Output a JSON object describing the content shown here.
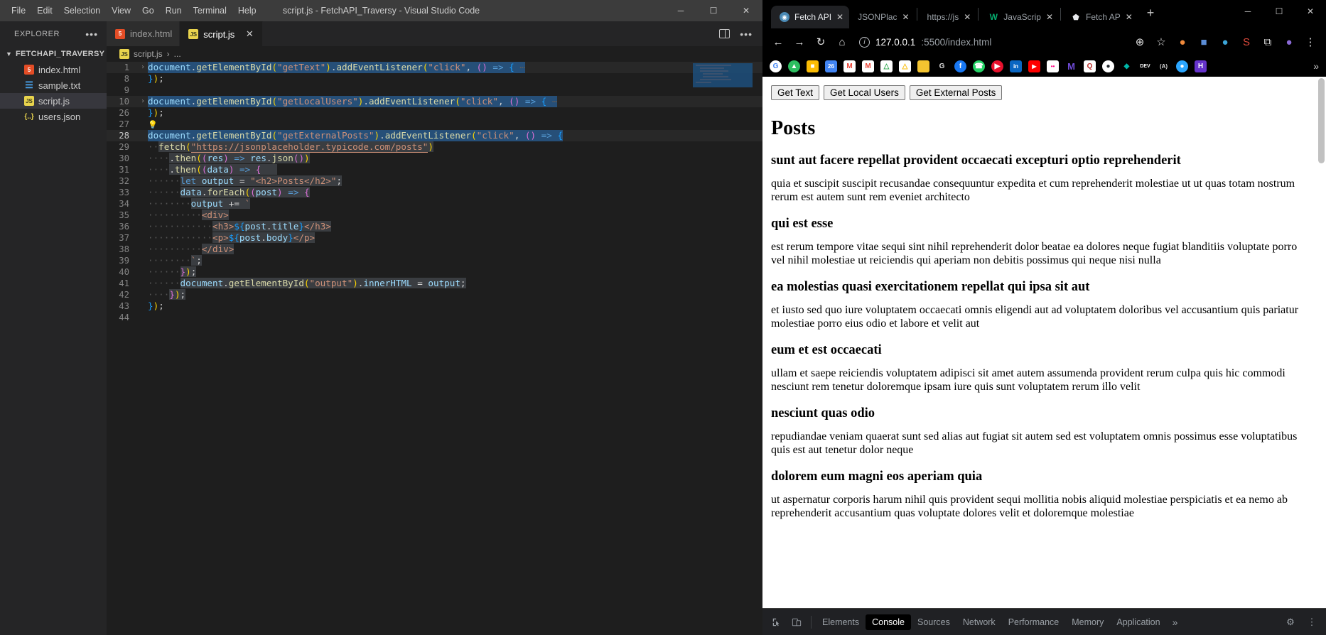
{
  "vscode": {
    "menu": [
      "File",
      "Edit",
      "Selection",
      "View",
      "Go",
      "Run",
      "Terminal",
      "Help"
    ],
    "window_title": "script.js - FetchAPI_Traversy - Visual Studio Code",
    "window_controls": {
      "minimize": "─",
      "maximize": "☐",
      "close": "✕"
    },
    "sidebar": {
      "header": "EXPLORER",
      "more": "•••",
      "root": "FETCHAPI_TRAVERSY",
      "files": [
        {
          "label": "index.html",
          "icon": "html5-icon",
          "glyph": "5",
          "selected": false
        },
        {
          "label": "sample.txt",
          "icon": "text-file-icon",
          "glyph": "☰",
          "selected": false
        },
        {
          "label": "script.js",
          "icon": "javascript-icon",
          "glyph": "JS",
          "selected": true
        },
        {
          "label": "users.json",
          "icon": "json-icon",
          "glyph": "{..}",
          "selected": false
        }
      ]
    },
    "tabs": [
      {
        "label": "index.html",
        "icon": "html5-icon",
        "glyph": "5",
        "active": false,
        "close": ""
      },
      {
        "label": "script.js",
        "icon": "javascript-icon",
        "glyph": "JS",
        "active": true,
        "close": "✕"
      }
    ],
    "tab_actions": {
      "split_editor": "split-editor-icon",
      "more": "•••"
    },
    "breadcrumb": {
      "icon_glyph": "JS",
      "file": "script.js",
      "chevron": "›",
      "rest": "..."
    },
    "code_lines": [
      {
        "num": "1",
        "fold": "›",
        "highlight": true
      },
      {
        "num": "8",
        "fold": "",
        "highlight": false
      },
      {
        "num": "9",
        "fold": "",
        "highlight": false
      },
      {
        "num": "10",
        "fold": "›",
        "highlight": true
      },
      {
        "num": "26",
        "fold": "",
        "highlight": false
      },
      {
        "num": "27",
        "fold": "",
        "highlight": false
      },
      {
        "num": "28",
        "fold": "",
        "highlight": true
      },
      {
        "num": "29",
        "fold": "",
        "highlight": false
      },
      {
        "num": "30",
        "fold": "",
        "highlight": false
      },
      {
        "num": "31",
        "fold": "",
        "highlight": false
      },
      {
        "num": "32",
        "fold": "",
        "highlight": false
      },
      {
        "num": "33",
        "fold": "",
        "highlight": false
      },
      {
        "num": "34",
        "fold": "",
        "highlight": false
      },
      {
        "num": "35",
        "fold": "",
        "highlight": false
      },
      {
        "num": "36",
        "fold": "",
        "highlight": false
      },
      {
        "num": "37",
        "fold": "",
        "highlight": false
      },
      {
        "num": "38",
        "fold": "",
        "highlight": false
      },
      {
        "num": "39",
        "fold": "",
        "highlight": false
      },
      {
        "num": "40",
        "fold": "",
        "highlight": false
      },
      {
        "num": "41",
        "fold": "",
        "highlight": false
      },
      {
        "num": "42",
        "fold": "",
        "highlight": false
      },
      {
        "num": "43",
        "fold": "",
        "highlight": false
      },
      {
        "num": "44",
        "fold": "",
        "highlight": false
      }
    ],
    "code_text": {
      "l1": "document.getElementById(\"getText\").addEventListener(\"click\", () => { ⋯",
      "l8": "});",
      "l9": "",
      "l10": "document.getElementById(\"getLocalUsers\").addEventListener(\"click\", () => { ⋯",
      "l26": "});",
      "l27": "💡",
      "l28": "document.getElementById(\"getExternalPosts\").addEventListener(\"click\", () => {",
      "l29": "  fetch(\"https://jsonplaceholder.typicode.com/posts\")",
      "l30": "    .then((res) => res.json())",
      "l31": "    .then((data) => {",
      "l32": "      let output = \"<h2>Posts</h2>\";",
      "l33": "      data.forEach((post) => {",
      "l34": "        output += `",
      "l35": "          <div>",
      "l36": "            <h3>${post.title}</h3>",
      "l37": "            <p>${post.body}</p>",
      "l38": "          </div>",
      "l39": "        `;",
      "l40": "      });",
      "l41": "      document.getElementById(\"output\").innerHTML = output;",
      "l42": "    });",
      "l43": "});",
      "l44": ""
    }
  },
  "browser": {
    "window_controls": {
      "minimize": "─",
      "maximize": "☐",
      "close": "✕"
    },
    "tabs": [
      {
        "label": "Fetch API",
        "favicon": "globe-icon",
        "glyph": "◉",
        "color": "#4b8ab5",
        "active": true,
        "close": "✕"
      },
      {
        "label": "JSONPlac",
        "favicon": "blank-page-icon",
        "glyph": "",
        "color": "transparent",
        "active": false,
        "close": "✕"
      },
      {
        "label": "https://js",
        "favicon": "blank-page-icon",
        "glyph": "",
        "color": "transparent",
        "active": false,
        "close": "✕"
      },
      {
        "label": "JavaScrip",
        "favicon": "w3schools-icon",
        "glyph": "W",
        "color": "#04aa6d",
        "active": false,
        "close": "✕"
      },
      {
        "label": "Fetch AP",
        "favicon": "diamond-icon",
        "glyph": "⬟",
        "color": "#e8eaed",
        "active": false,
        "close": "✕"
      }
    ],
    "new_tab": "+",
    "toolbar": {
      "back": "←",
      "forward": "→",
      "reload": "↻",
      "home": "⌂",
      "info_icon": "site-information-icon",
      "url_host": "127.0.0.1",
      "url_rest": ":5500/index.html",
      "zoom_icon": "⊕",
      "bookmark_star": "☆",
      "menu_dots": "⋮",
      "extensions": "⧉"
    },
    "bookmarks": [
      {
        "name": "google-bookmark",
        "glyph": "G",
        "color": "#ffffff",
        "fg": "#4285f4",
        "round": true
      },
      {
        "name": "evernote-bookmark",
        "glyph": "▲",
        "color": "#2dbe60",
        "fg": "#ffffff",
        "round": true
      },
      {
        "name": "keep-bookmark",
        "glyph": "■",
        "color": "#fbbc04",
        "fg": "#ffffff",
        "round": false
      },
      {
        "name": "calendar-bookmark",
        "glyph": "26",
        "color": "#4285f4",
        "fg": "#ffffff",
        "round": false
      },
      {
        "name": "gmail-bookmark",
        "glyph": "M",
        "color": "#ffffff",
        "fg": "#ea4335",
        "round": false
      },
      {
        "name": "gmail2-bookmark",
        "glyph": "M",
        "color": "#ffffff",
        "fg": "#ea4335",
        "round": false
      },
      {
        "name": "drive-bookmark",
        "glyph": "△",
        "color": "#ffffff",
        "fg": "#34a853",
        "round": false
      },
      {
        "name": "drive2-bookmark",
        "glyph": "△",
        "color": "#ffffff",
        "fg": "#fbbc04",
        "round": false
      },
      {
        "name": "folder-bookmark",
        "glyph": "",
        "color": "#f4c430",
        "fg": "#ffffff",
        "round": false
      },
      {
        "name": "g-bookmark",
        "glyph": "G",
        "color": "#ffffff",
        "fg": "#dddddd",
        "round": false
      },
      {
        "name": "facebook-bookmark",
        "glyph": "f",
        "color": "#1877f2",
        "fg": "#ffffff",
        "round": true
      },
      {
        "name": "whatsapp-bookmark",
        "glyph": "☎",
        "color": "#25d366",
        "fg": "#ffffff",
        "round": true
      },
      {
        "name": "youtube-music-bookmark",
        "glyph": "▶",
        "color": "#e8112d",
        "fg": "#ffffff",
        "round": true
      },
      {
        "name": "linkedin-bookmark",
        "glyph": "in",
        "color": "#0a66c2",
        "fg": "#ffffff",
        "round": false
      },
      {
        "name": "youtube-bookmark",
        "glyph": "▶",
        "color": "#ff0000",
        "fg": "#ffffff",
        "round": false
      },
      {
        "name": "flickr-bookmark",
        "glyph": "••",
        "color": "#ffffff",
        "fg": "#ff0084",
        "round": false
      },
      {
        "name": "medium-bookmark",
        "glyph": "M",
        "color": "#3b0ca3",
        "fg": "#ffffff",
        "round": false
      },
      {
        "name": "quora-bookmark",
        "glyph": "Q",
        "color": "#b92b27",
        "fg": "#ffffff",
        "round": false
      },
      {
        "name": "github-bookmark",
        "glyph": "●",
        "color": "#ffffff",
        "fg": "#24292e",
        "round": true
      },
      {
        "name": "teal-bookmark",
        "glyph": "◆",
        "color": "#00b8a9",
        "fg": "#ffffff",
        "round": false
      },
      {
        "name": "dev-bookmark",
        "glyph": "DEV",
        "color": "#ffffff",
        "fg": "#000000",
        "round": false
      },
      {
        "name": "a-bookmark",
        "glyph": "(A)",
        "color": "#ffffff",
        "fg": "#dddddd",
        "round": false
      },
      {
        "name": "tenor-bookmark",
        "glyph": "●",
        "color": "#2ba6ff",
        "fg": "#ffffff",
        "round": true
      },
      {
        "name": "h-bookmark",
        "glyph": "H",
        "color": "#6633cc",
        "fg": "#ffffff",
        "round": false
      }
    ],
    "bookmarks_overflow": "»",
    "page": {
      "buttons": [
        {
          "name": "get-text-button",
          "label": "Get Text"
        },
        {
          "name": "get-local-users-button",
          "label": "Get Local Users"
        },
        {
          "name": "get-external-posts-button",
          "label": "Get External Posts"
        }
      ],
      "heading": "Posts",
      "posts": [
        {
          "title": "sunt aut facere repellat provident occaecati excepturi optio reprehenderit",
          "body": "quia et suscipit suscipit recusandae consequuntur expedita et cum reprehenderit molestiae ut ut quas totam nostrum rerum est autem sunt rem eveniet architecto"
        },
        {
          "title": "qui est esse",
          "body": "est rerum tempore vitae sequi sint nihil reprehenderit dolor beatae ea dolores neque fugiat blanditiis voluptate porro vel nihil molestiae ut reiciendis qui aperiam non debitis possimus qui neque nisi nulla"
        },
        {
          "title": "ea molestias quasi exercitationem repellat qui ipsa sit aut",
          "body": "et iusto sed quo iure voluptatem occaecati omnis eligendi aut ad voluptatem doloribus vel accusantium quis pariatur molestiae porro eius odio et labore et velit aut"
        },
        {
          "title": "eum et est occaecati",
          "body": "ullam et saepe reiciendis voluptatem adipisci sit amet autem assumenda provident rerum culpa quis hic commodi nesciunt rem tenetur doloremque ipsam iure quis sunt voluptatem rerum illo velit"
        },
        {
          "title": "nesciunt quas odio",
          "body": "repudiandae veniam quaerat sunt sed alias aut fugiat sit autem sed est voluptatem omnis possimus esse voluptatibus quis est aut tenetur dolor neque"
        },
        {
          "title": "dolorem eum magni eos aperiam quia",
          "body": "ut aspernatur corporis harum nihil quis provident sequi mollitia nobis aliquid molestiae perspiciatis et ea nemo ab reprehenderit accusantium quas voluptate dolores velit et doloremque molestiae"
        }
      ]
    },
    "devtools": {
      "inspect_icon": "inspect-element-icon",
      "device_icon": "device-toolbar-icon",
      "tabs": [
        {
          "label": "Elements",
          "active": false
        },
        {
          "label": "Console",
          "active": true
        },
        {
          "label": "Sources",
          "active": false
        },
        {
          "label": "Network",
          "active": false
        },
        {
          "label": "Performance",
          "active": false
        },
        {
          "label": "Memory",
          "active": false
        },
        {
          "label": "Application",
          "active": false
        }
      ],
      "overflow": "»",
      "settings_icon": "⚙",
      "menu_icon": "⋮"
    }
  }
}
